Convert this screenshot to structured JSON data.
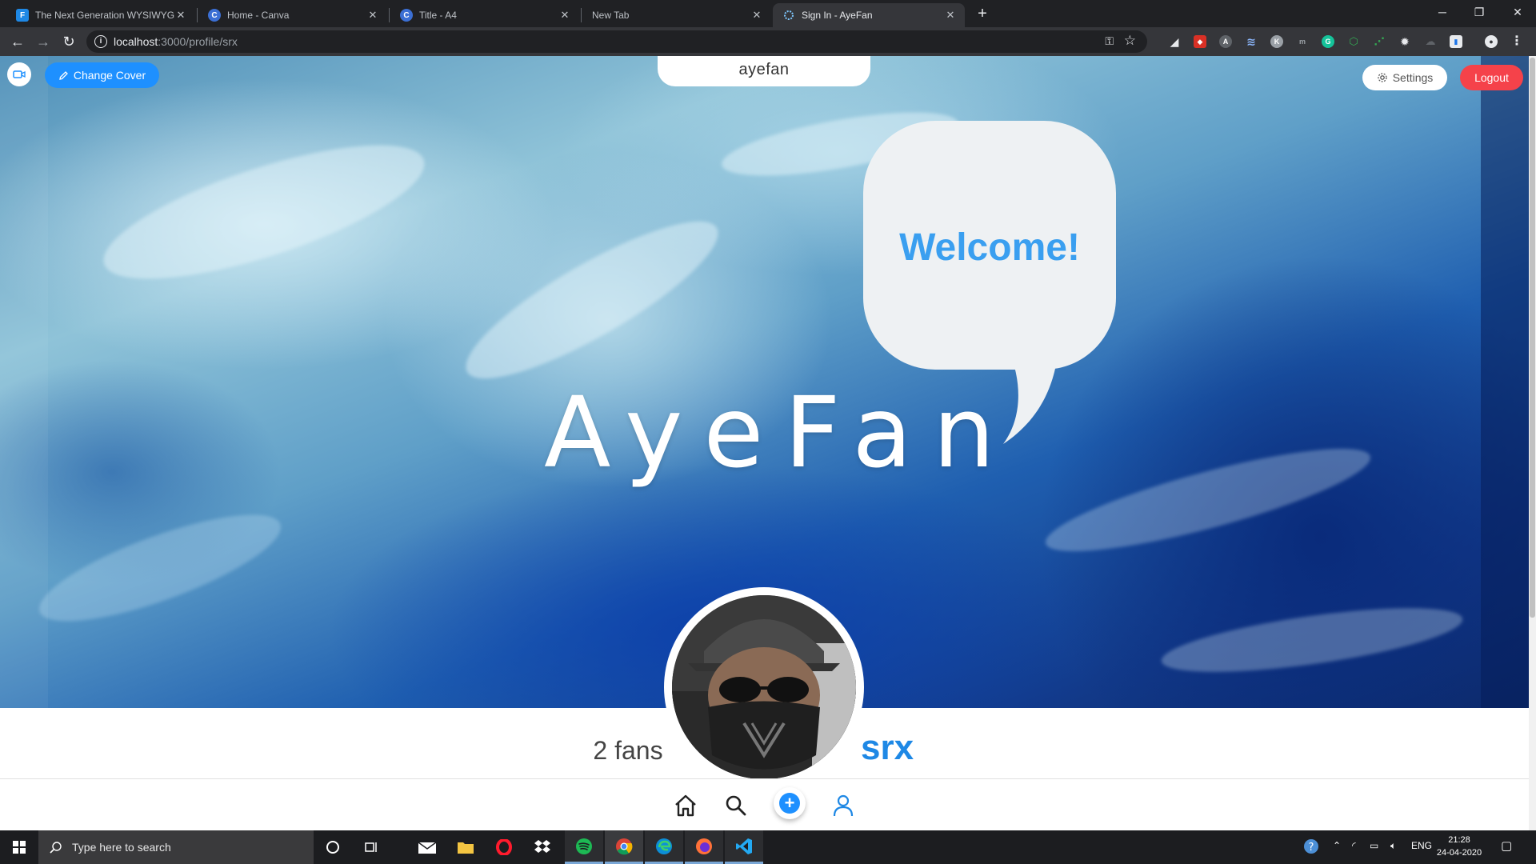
{
  "browser": {
    "tabs": [
      {
        "title": "The Next Generation WYSIWYG H",
        "favicon": "F",
        "favicon_color": "#1e88e5"
      },
      {
        "title": "Home - Canva",
        "favicon": "C",
        "favicon_color": "#3b6fd4"
      },
      {
        "title": "Title - A4",
        "favicon": "C",
        "favicon_color": "#3b6fd4"
      },
      {
        "title": "New Tab",
        "favicon": "",
        "favicon_color": ""
      },
      {
        "title": "Sign In - AyeFan",
        "favicon": "",
        "favicon_color": "#7fc8ff"
      }
    ],
    "url_host": "localhost",
    "url_path": ":3000/profile/srx"
  },
  "header": {
    "change_cover_label": "Change Cover",
    "brand": "ayefan",
    "settings_label": "Settings",
    "logout_label": "Logout"
  },
  "cover": {
    "welcome_text": "Welcome!",
    "hero_title": "AyeFan"
  },
  "profile": {
    "fans": "2 fans",
    "username": "srx"
  },
  "taskbar": {
    "search_placeholder": "Type here to search",
    "language": "ENG",
    "time": "21:28",
    "date": "24-04-2020"
  },
  "colors": {
    "accent": "#1e90ff",
    "logout": "#f5424a",
    "username": "#1e88e5",
    "welcome": "#3a9ff0"
  }
}
